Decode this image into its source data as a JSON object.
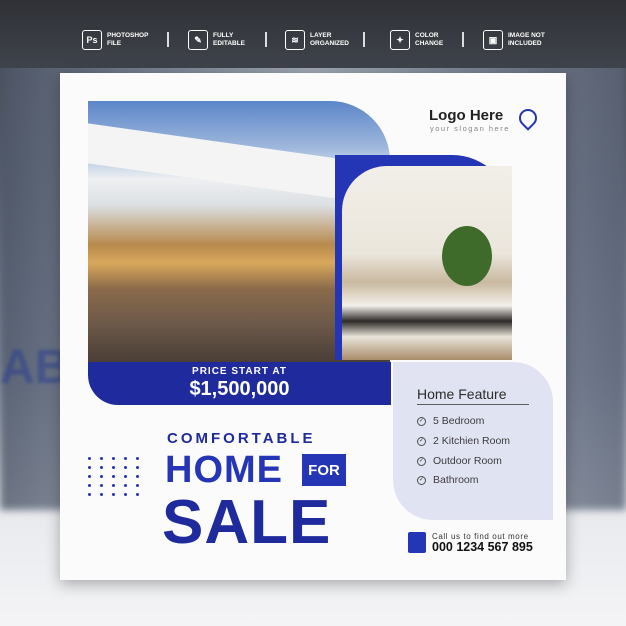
{
  "top_features": [
    {
      "icon": "photoshop-icon",
      "glyph": "Ps",
      "label": "PHOTOSHOP\nFILE"
    },
    {
      "icon": "edit-icon",
      "glyph": "✎",
      "label": "FULLY\nEDITABLE"
    },
    {
      "icon": "layers-icon",
      "glyph": "≋",
      "label": "LAYER\nORGANIZED"
    },
    {
      "icon": "color-change-icon",
      "glyph": "✦",
      "label": "COLOR\nCHANGE"
    },
    {
      "icon": "image-icon",
      "glyph": "▣",
      "label": "IMAGE NOT\nINCLUDED"
    }
  ],
  "logo": {
    "text": "Logo Here",
    "slogan": "your slogan here"
  },
  "price": {
    "label": "PRICE START AT",
    "value": "$1,500,000"
  },
  "headline": {
    "line1": "COMFORTABLE",
    "home": "HOME",
    "for": "FOR",
    "sale": "SALE"
  },
  "features": {
    "title": "Home Feature",
    "items": [
      "5 Bedroom",
      "2 Kitchien Room",
      "Outdoor Room",
      "Bathroom"
    ]
  },
  "contact": {
    "text": "Call us to find out more",
    "phone": "000 1234 567 895"
  },
  "colors": {
    "brand_blue": "#2435b5",
    "dark_blue": "#1f2a9c",
    "panel": "#dfe2f1"
  }
}
